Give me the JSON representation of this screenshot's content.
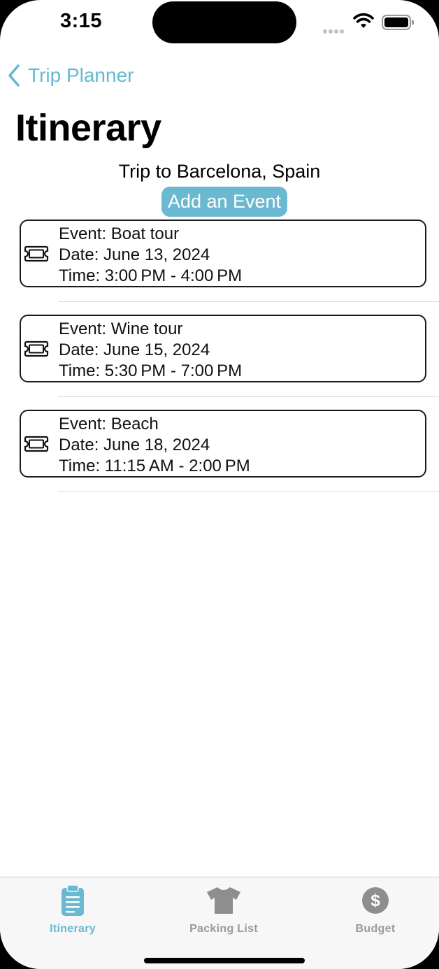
{
  "status_bar": {
    "time": "3:15"
  },
  "nav": {
    "back_label": "Trip Planner",
    "title": "Itinerary"
  },
  "trip": {
    "title": "Trip to Barcelona, Spain"
  },
  "add_event_label": "Add an Event",
  "events": [
    {
      "event": "Event: Boat tour",
      "date": "Date: June 13, 2024",
      "time": "Time: 3:00 PM - 4:00 PM"
    },
    {
      "event": "Event: Wine tour",
      "date": "Date: June 15, 2024",
      "time": "Time: 5:30 PM - 7:00 PM"
    },
    {
      "event": "Event: Beach",
      "date": "Date: June 18, 2024",
      "time": "Time: 11:15 AM - 2:00 PM"
    }
  ],
  "tabs": [
    {
      "label": "Itinerary",
      "icon": "clipboard-icon",
      "active": true
    },
    {
      "label": "Packing List",
      "icon": "tshirt-icon",
      "active": false
    },
    {
      "label": "Budget",
      "icon": "dollar-circle-icon",
      "active": false
    }
  ],
  "colors": {
    "accent": "#6ab9d1",
    "inactive": "#8e8e8e",
    "card_border": "#1a1a1a"
  }
}
